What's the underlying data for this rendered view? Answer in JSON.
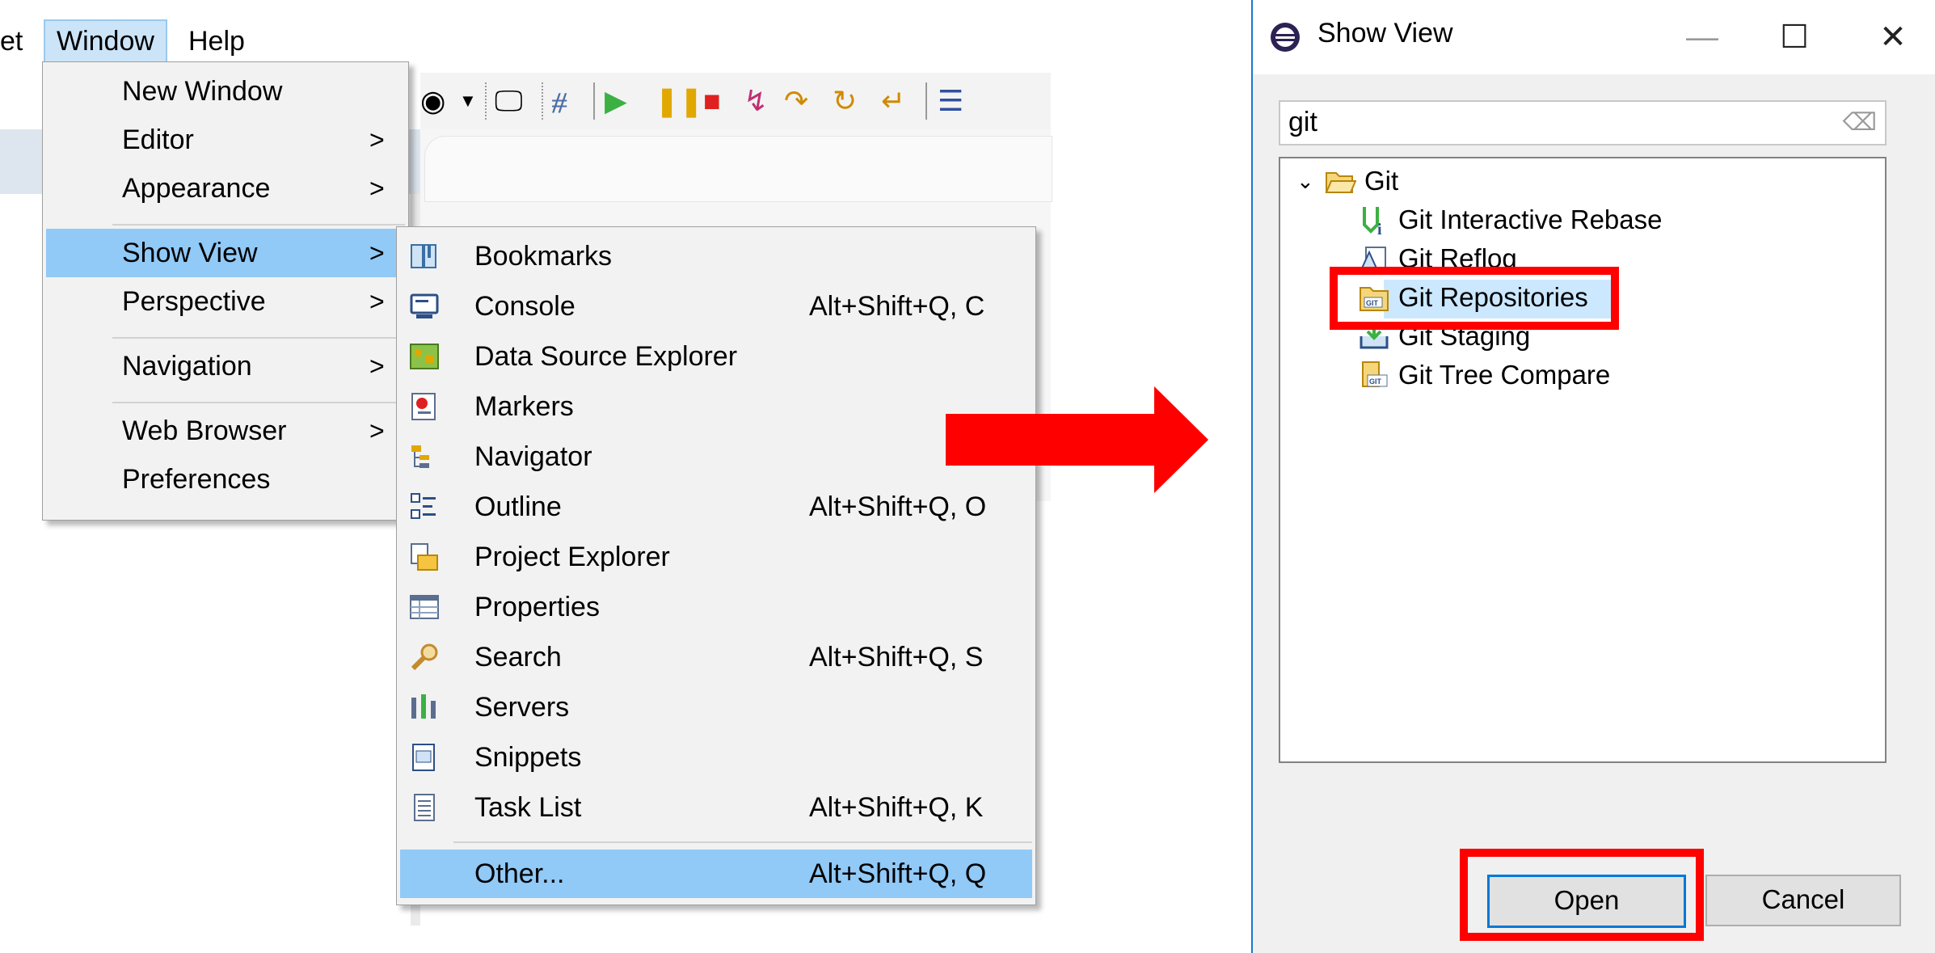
{
  "menubar": {
    "prev_item": "et",
    "items": [
      "Window",
      "Help"
    ]
  },
  "window_menu": {
    "items": [
      {
        "label": "New Window",
        "submenu": false
      },
      {
        "label": "Editor",
        "submenu": true
      },
      {
        "label": "Appearance",
        "submenu": true
      },
      {
        "label": "Show View",
        "submenu": true,
        "highlighted": true
      },
      {
        "label": "Perspective",
        "submenu": true
      },
      {
        "label": "Navigation",
        "submenu": true
      },
      {
        "label": "Web Browser",
        "submenu": true
      },
      {
        "label": "Preferences",
        "submenu": false
      }
    ],
    "arrow": ">"
  },
  "show_view_menu": {
    "items": [
      {
        "label": "Bookmarks",
        "shortcut": "",
        "icon": "bookmarks-icon"
      },
      {
        "label": "Console",
        "shortcut": "Alt+Shift+Q, C",
        "icon": "console-icon"
      },
      {
        "label": "Data Source Explorer",
        "shortcut": "",
        "icon": "data-source-explorer-icon"
      },
      {
        "label": "Markers",
        "shortcut": "",
        "icon": "markers-icon"
      },
      {
        "label": "Navigator",
        "shortcut": "",
        "icon": "navigator-icon"
      },
      {
        "label": "Outline",
        "shortcut": "Alt+Shift+Q, O",
        "icon": "outline-icon"
      },
      {
        "label": "Project Explorer",
        "shortcut": "",
        "icon": "project-explorer-icon"
      },
      {
        "label": "Properties",
        "shortcut": "",
        "icon": "properties-icon"
      },
      {
        "label": "Search",
        "shortcut": "Alt+Shift+Q, S",
        "icon": "search-icon"
      },
      {
        "label": "Servers",
        "shortcut": "",
        "icon": "servers-icon"
      },
      {
        "label": "Snippets",
        "shortcut": "",
        "icon": "snippets-icon"
      },
      {
        "label": "Task List",
        "shortcut": "Alt+Shift+Q, K",
        "icon": "task-list-icon"
      },
      {
        "label": "Other...",
        "shortcut": "Alt+Shift+Q, Q",
        "icon": "",
        "highlighted": true
      }
    ]
  },
  "toolbar": {
    "icons": [
      "avatar-icon",
      "dropdown-icon",
      "display-icon",
      "skip-breakpoints-icon",
      "resume-icon",
      "suspend-icon",
      "terminate-icon",
      "disconnect-icon",
      "step-into-icon",
      "step-over-icon",
      "step-return-icon",
      "menu-icon"
    ]
  },
  "dialog": {
    "title": "Show View",
    "window_buttons": {
      "minimize": "—",
      "maximize": "☐",
      "close": "✕"
    },
    "filter_value": "git",
    "tree": {
      "folder": "Git",
      "children": [
        "Git Interactive Rebase",
        "Git Reflog",
        "Git Repositories",
        "Git Staging",
        "Git Tree Compare"
      ],
      "selected": "Git Repositories"
    },
    "open_label": "Open",
    "cancel_label": "Cancel"
  },
  "colors": {
    "highlight": "#91c9f7",
    "annotation_red": "#ff0000",
    "dialog_border": "#1979ca",
    "selection": "#cce8ff"
  }
}
